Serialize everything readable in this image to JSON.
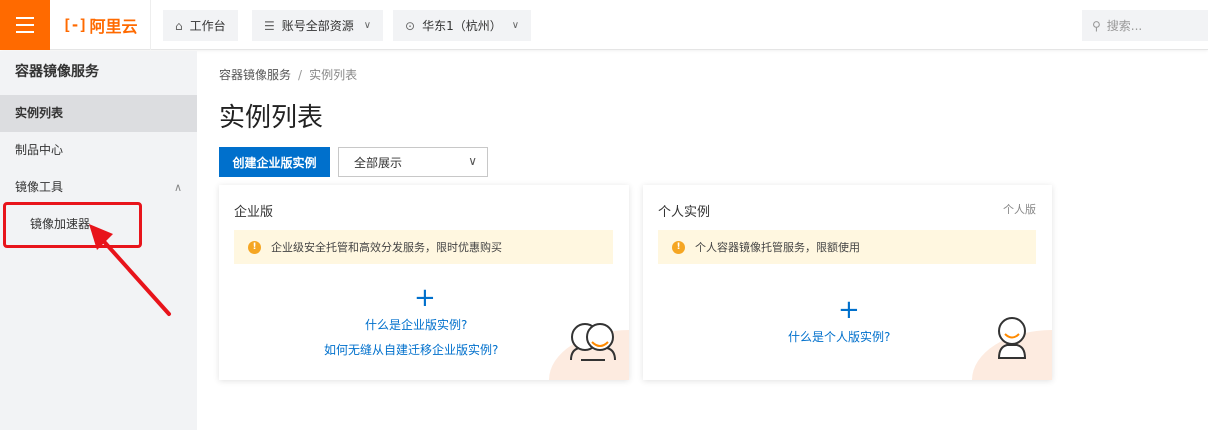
{
  "topbar": {
    "brand": "阿里云",
    "brand_mark": "[-]",
    "workbench": "工作台",
    "resources": "账号全部资源",
    "region": "华东1（杭州）",
    "search_placeholder": "搜索..."
  },
  "sidebar": {
    "title": "容器镜像服务",
    "items": [
      {
        "label": "实例列表"
      },
      {
        "label": "制品中心"
      },
      {
        "label": "镜像工具"
      }
    ],
    "subitems": [
      {
        "label": "镜像加速器"
      }
    ]
  },
  "breadcrumb": {
    "root": "容器镜像服务",
    "separator": "/",
    "current": "实例列表"
  },
  "page": {
    "title": "实例列表",
    "create_button": "创建企业版实例",
    "filter_value": "全部展示"
  },
  "cards": {
    "enterprise": {
      "title": "企业版",
      "notice": "企业级安全托管和高效分发服务，限时优惠购买",
      "link1": "什么是企业版实例?",
      "link2": "如何无缝从自建迁移企业版实例?"
    },
    "personal": {
      "title": "个人实例",
      "tag": "个人版",
      "notice": "个人容器镜像托管服务，限额使用",
      "link1": "什么是个人版实例?"
    }
  },
  "colors": {
    "brand_orange": "#ff6a00",
    "primary_blue": "#0070cc",
    "annotation_red": "#e8141b",
    "notice_bg": "#fff7e0"
  }
}
